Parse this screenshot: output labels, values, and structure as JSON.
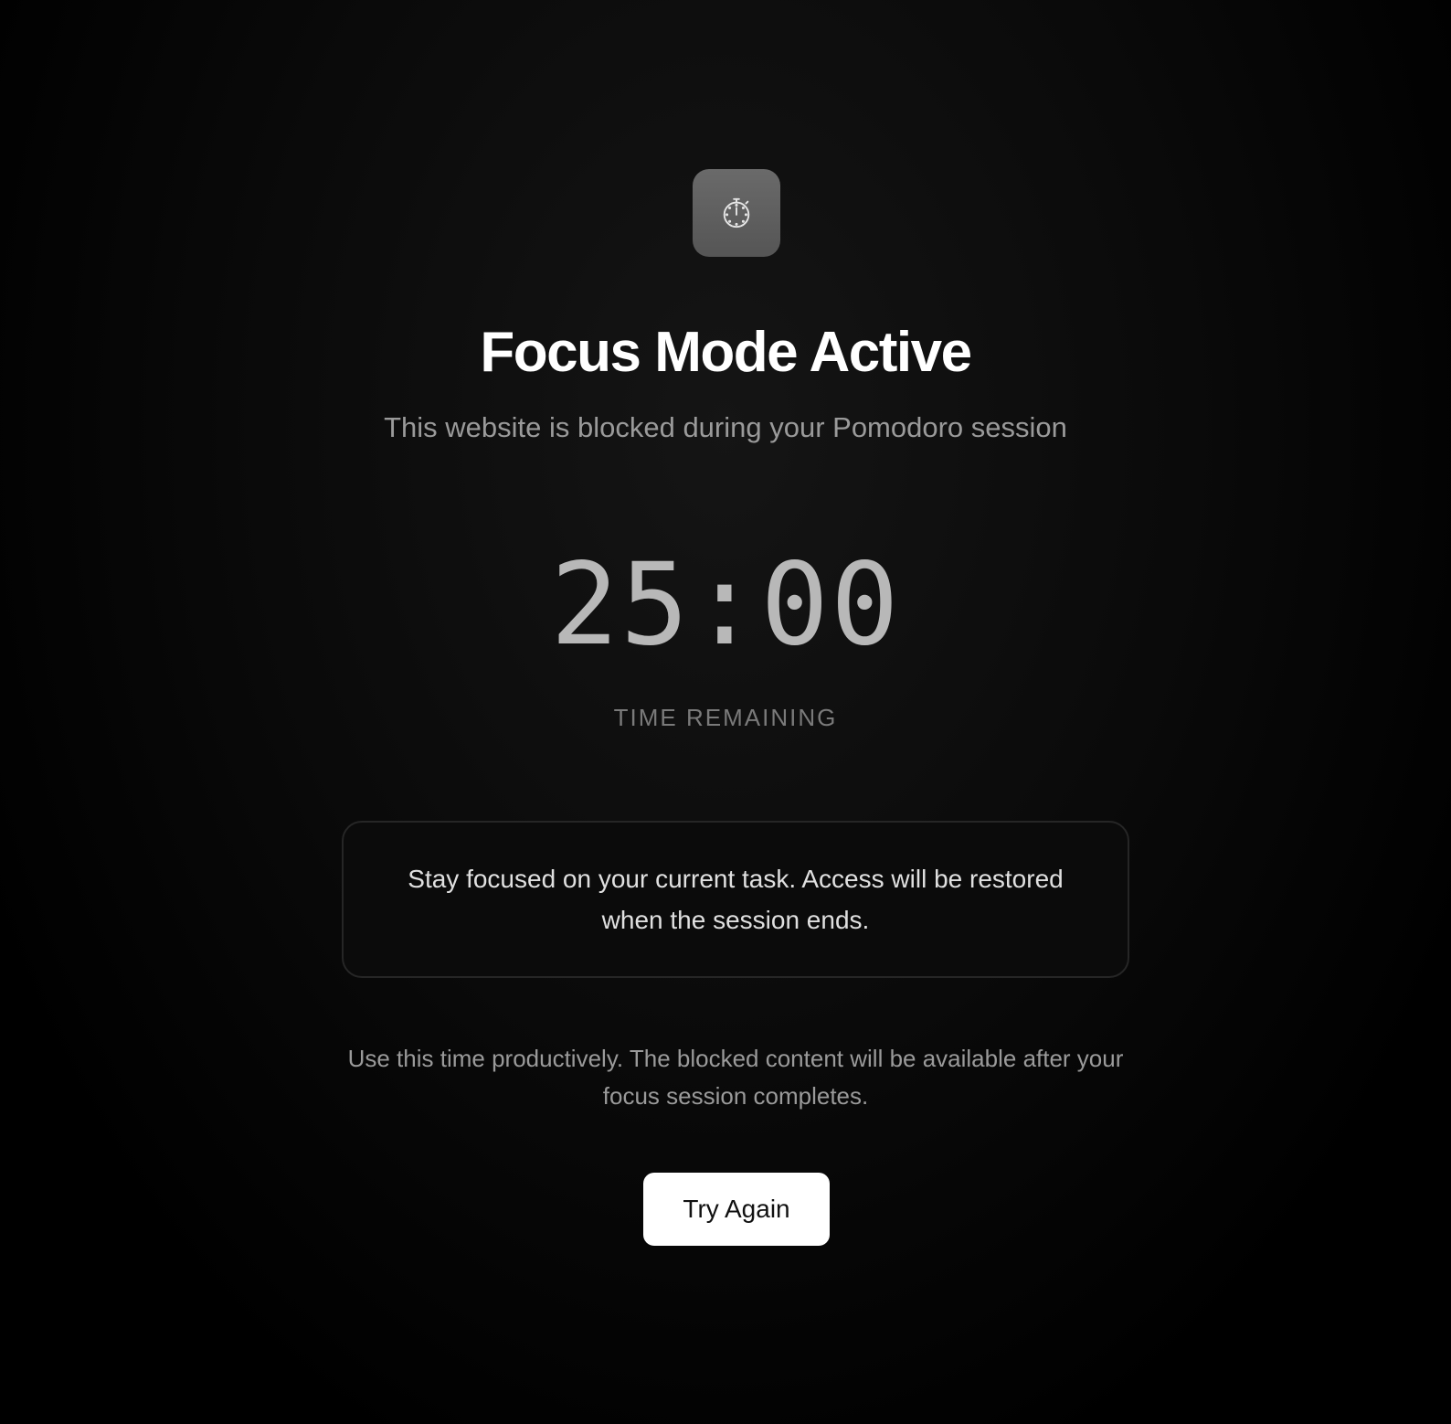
{
  "icon": {
    "name": "stopwatch-icon"
  },
  "header": {
    "title": "Focus Mode Active",
    "subtitle": "This website is blocked during your Pomodoro session"
  },
  "timer": {
    "value": "25:00",
    "label": "TIME REMAINING"
  },
  "message": {
    "text": "Stay focused on your current task. Access will be restored when the session ends."
  },
  "note": {
    "text": "Use this time productively. The blocked content will be available after your focus session completes."
  },
  "actions": {
    "try_again_label": "Try Again"
  },
  "colors": {
    "background": "#000000",
    "icon_tile": "#5f5f5f",
    "button_background": "#ffffff",
    "timer_text": "#b8b8b8",
    "muted_text": "#9a9a9a"
  }
}
